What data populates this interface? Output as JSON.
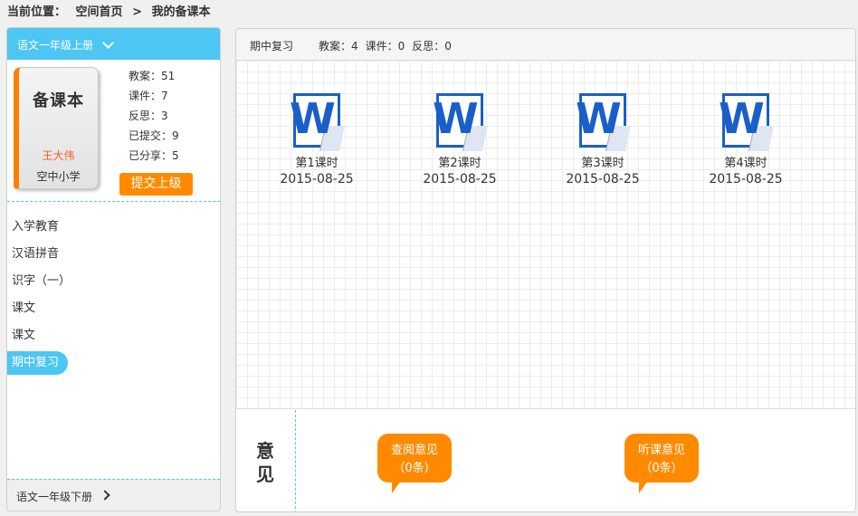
{
  "breadcrumb": {
    "label": "当前位置：",
    "home": "空间首页",
    "separator": ">",
    "current": "我的备课本"
  },
  "sidebar": {
    "grade_selector": "语文一年级上册",
    "book": {
      "title": "备课本",
      "author": "王大伟",
      "school": "空中小学"
    },
    "stats": {
      "lesson_plans": "教案：51",
      "courseware": "课件：7",
      "reflections": "反思：3",
      "submitted": "已提交：9",
      "shared": "已分享：5"
    },
    "submit_label": "提交上级",
    "units": [
      "入学教育",
      "汉语拼音",
      "识字（一）",
      "课文",
      "课文",
      "期中复习"
    ],
    "active_unit_index": 5,
    "footer_grade": "语文一年级下册"
  },
  "main": {
    "header": {
      "unit": "期中复习",
      "lesson_plans": "教案：4",
      "courseware": "课件：0",
      "reflections": "反思：0"
    },
    "files": [
      {
        "name": "第1课时",
        "date": "2015-08-25",
        "icon": "word-doc-icon"
      },
      {
        "name": "第2课时",
        "date": "2015-08-25",
        "icon": "word-doc-icon"
      },
      {
        "name": "第3课时",
        "date": "2015-08-25",
        "icon": "word-doc-icon"
      },
      {
        "name": "第4课时",
        "date": "2015-08-25",
        "icon": "word-doc-icon"
      }
    ],
    "opinion": {
      "label_1": "意",
      "label_2": "见",
      "review": {
        "title": "查阅意见",
        "count": "（0条）"
      },
      "listen": {
        "title": "听课意见",
        "count": "（0条）"
      }
    }
  },
  "colors": {
    "accent_blue": "#4ec6f3",
    "accent_orange": "#ff8a00",
    "word_blue": "#1a5fc9"
  }
}
